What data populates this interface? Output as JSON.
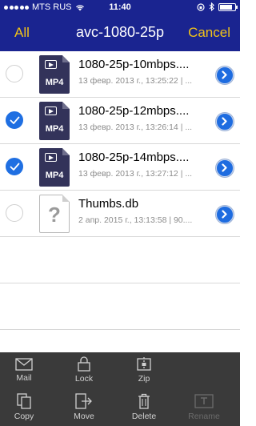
{
  "status_bar": {
    "carrier": "MTS RUS",
    "time": "11:40",
    "battery_level": 0.85
  },
  "nav": {
    "left_button": "All",
    "title": "avc-1080-25p",
    "right_button": "Cancel"
  },
  "files": [
    {
      "name": "1080-25p-10mbps....",
      "meta": "13 февр. 2013 г., 13:25:22 | ...",
      "type": "MP4",
      "icon": "mp4-file-icon",
      "selected": false
    },
    {
      "name": "1080-25p-12mbps....",
      "meta": "13 февр. 2013 г., 13:26:14 | ...",
      "type": "MP4",
      "icon": "mp4-file-icon",
      "selected": true
    },
    {
      "name": "1080-25p-14mbps....",
      "meta": "13 февр. 2013 г., 13:27:12 | ...",
      "type": "MP4",
      "icon": "mp4-file-icon",
      "selected": true
    },
    {
      "name": "Thumbs.db",
      "meta": "2 апр. 2015 г., 13:13:58 | 90....",
      "type": "?",
      "icon": "unknown-file-icon",
      "selected": false
    }
  ],
  "toolbar": {
    "mail": "Mail",
    "lock": "Lock",
    "zip": "Zip",
    "copy": "Copy",
    "move": "Move",
    "delete": "Delete",
    "rename": "Rename"
  },
  "colors": {
    "bar": "#1a2490",
    "accent": "#f2c318",
    "check": "#1f6fe2",
    "toolbar": "#3a3a3a"
  }
}
